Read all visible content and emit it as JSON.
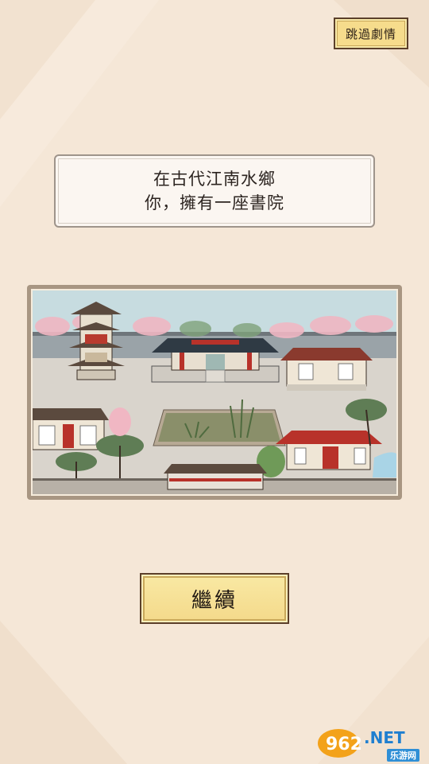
{
  "header": {
    "skip_label": "跳過劇情"
  },
  "dialog": {
    "line1": "在古代江南水鄉",
    "line2": "你，擁有一座書院"
  },
  "footer": {
    "continue_label": "繼續"
  },
  "watermark": {
    "logo_text": "962.NET",
    "sub_text": "乐游网"
  },
  "colors": {
    "background": "#f5e7d7",
    "button_fill": "#f6dc8c",
    "button_border": "#5b3f2a",
    "dialog_fill": "#fbf6f1"
  }
}
